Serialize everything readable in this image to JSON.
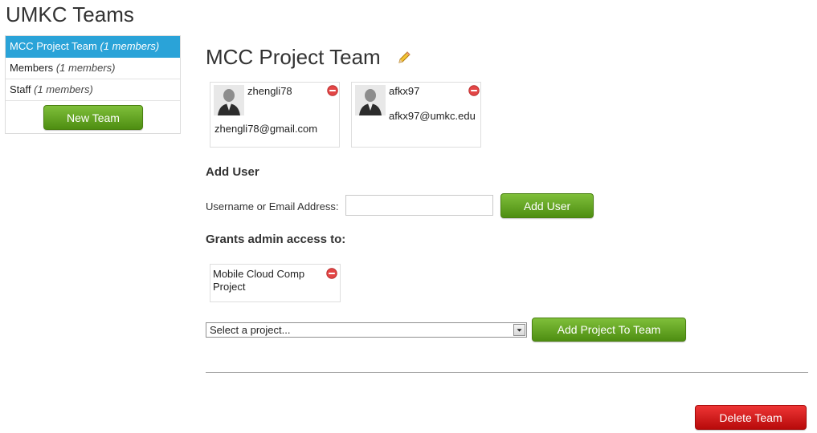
{
  "app": {
    "title": "UMKC Teams"
  },
  "sidebar": {
    "teams": [
      {
        "name": "MCC Project Team",
        "count": "(1 members)",
        "active": true
      },
      {
        "name": "Members",
        "count": "(1 members)",
        "active": false
      },
      {
        "name": "Staff",
        "count": "(1 members)",
        "active": false
      }
    ],
    "new_team_label": "New Team"
  },
  "team": {
    "name": "MCC Project Team",
    "members": [
      {
        "username": "zhengli78",
        "email": "zhengli78@gmail.com"
      },
      {
        "username": "afkx97",
        "email": "afkx97@umkc.edu"
      }
    ]
  },
  "add_user": {
    "heading": "Add User",
    "field_label": "Username or Email Address:",
    "field_value": "",
    "field_placeholder": "",
    "button_label": "Add User"
  },
  "grants": {
    "heading": "Grants admin access to:",
    "projects": [
      {
        "name": "Mobile Cloud Comp Project"
      }
    ],
    "select_value": "Select a project...",
    "add_button_label": "Add Project To Team"
  },
  "footer": {
    "delete_label": "Delete Team"
  },
  "colors": {
    "accent": "#2aa3d8",
    "green": "#5a9a1c",
    "red": "#d01616"
  }
}
